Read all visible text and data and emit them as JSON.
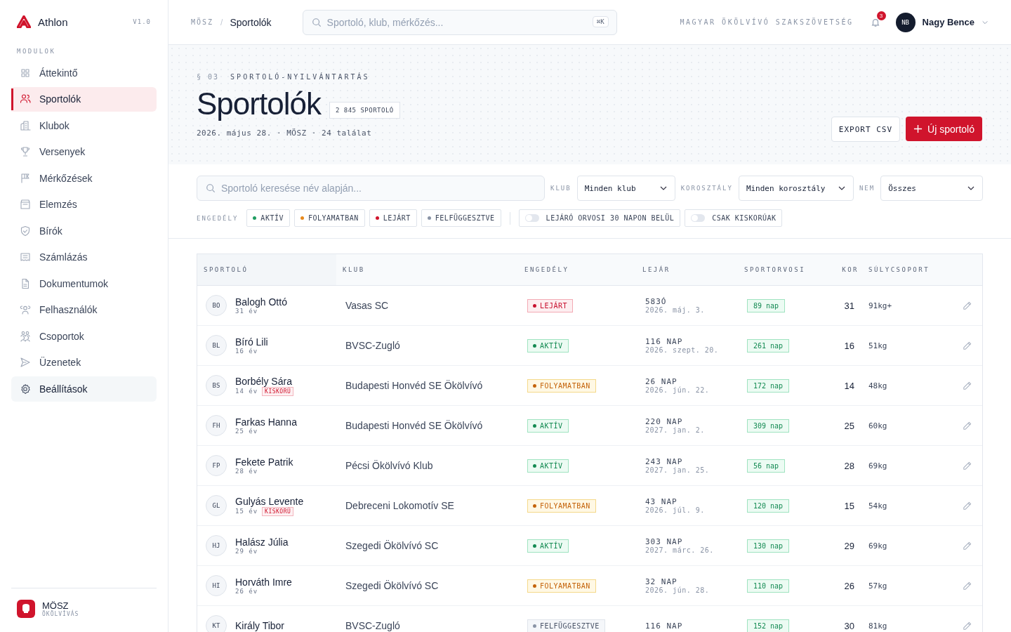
{
  "brand": {
    "name": "Athlon",
    "version": "V1.0"
  },
  "sidebar": {
    "section": "MODULOK",
    "items": [
      {
        "label": "Áttekintő",
        "selected": false,
        "highlighted": false
      },
      {
        "label": "Sportolók",
        "selected": true,
        "highlighted": false
      },
      {
        "label": "Klubok",
        "selected": false,
        "highlighted": false
      },
      {
        "label": "Versenyek",
        "selected": false,
        "highlighted": false
      },
      {
        "label": "Mérkőzések",
        "selected": false,
        "highlighted": false
      },
      {
        "label": "Elemzés",
        "selected": false,
        "highlighted": false
      },
      {
        "label": "Bírók",
        "selected": false,
        "highlighted": false
      },
      {
        "label": "Számlázás",
        "selected": false,
        "highlighted": false
      },
      {
        "label": "Dokumentumok",
        "selected": false,
        "highlighted": false
      },
      {
        "label": "Felhasználók",
        "selected": false,
        "highlighted": false
      },
      {
        "label": "Csoportok",
        "selected": false,
        "highlighted": false
      },
      {
        "label": "Üzenetek",
        "selected": false,
        "highlighted": false
      },
      {
        "label": "Beállítások",
        "selected": false,
        "highlighted": true
      }
    ],
    "footer": {
      "title": "MÖSZ",
      "subtitle": "ÖKÖLVÍVÁS"
    }
  },
  "topbar": {
    "breadcrumb": [
      "MÖSZ",
      "Sportolók"
    ],
    "breadcrumb_separator": "/",
    "search": {
      "placeholder": "Sportoló, klub, mérkőzés...",
      "shortcut": "⌘K"
    },
    "organization": "MAGYAR ÖKÖLVÍVÓ SZAKSZÖVETSÉG",
    "notifications": "3",
    "user": {
      "initials": "NB",
      "name": "Nagy Bence"
    }
  },
  "header": {
    "section": "§ 03",
    "eyebrow": "SPORTOLÓ-NYILVÁNTARTÁS",
    "title": "Sportolók",
    "count": "2 845 SPORTOLÓ",
    "meta": "2026. május 28. · MÖSZ · 24 találat",
    "buttons": [
      {
        "label": "EXPORT CSV",
        "kind": "secondary"
      },
      {
        "label": "Új sportoló",
        "kind": "primary"
      }
    ]
  },
  "filters": {
    "search": {
      "placeholder": "Sportoló keresése név alapján..."
    },
    "selects": [
      {
        "label": "KLUB",
        "value": "Minden klub"
      },
      {
        "label": "KOROSZTÁLY",
        "value": "Minden korosztály"
      },
      {
        "label": "NEM",
        "value": "Összes"
      }
    ],
    "license_label": "ENGEDÉLY",
    "license": [
      {
        "label": "AKTÍV",
        "color": "#1f9d61"
      },
      {
        "label": "FOLYAMATBAN",
        "color": "#e8891c"
      },
      {
        "label": "LEJÁRT",
        "color": "#d0142c"
      },
      {
        "label": "FELFÜGGESZTVE",
        "color": "#8a94a6"
      }
    ],
    "toggles": [
      {
        "label": "LEJÁRÓ ORVOSI 30 NAPON BELÜL",
        "on": false
      },
      {
        "label": "CSAK KISKORÚAK",
        "on": false
      }
    ]
  },
  "table": {
    "columns": [
      "SPORTOLÓ",
      "KLUB",
      "ENGEDÉLY",
      "LEJÁR",
      "SPORTORVOSI",
      "KOR",
      "SÚLYCSOPORT"
    ],
    "rows": [
      {
        "initials": "BO",
        "name": "Balogh Ottó",
        "years": "31 év",
        "club": "Vasas SC",
        "status": {
          "label": "LEJÁRT",
          "kind": "expired"
        },
        "expiry": "583Ó",
        "expiry_date": "2026. máj. 3.",
        "medical": "89 nap",
        "age": "31",
        "weight": "91kg+"
      },
      {
        "initials": "BL",
        "name": "Bíró Lili",
        "years": "16 év",
        "club": "BVSC-Zugló",
        "status": {
          "label": "AKTÍV",
          "kind": "active"
        },
        "expiry": "116 NAP",
        "expiry_date": "2026. szept. 20.",
        "medical": "261 nap",
        "age": "16",
        "weight": "51kg"
      },
      {
        "initials": "BS",
        "name": "Borbély Sára",
        "years": "14 év",
        "tag": "KISKORÚ",
        "club": "Budapesti Honvéd SE Ökölvívó",
        "status": {
          "label": "FOLYAMATBAN",
          "kind": "pending"
        },
        "expiry": "26 NAP",
        "expiry_date": "2026. jún. 22.",
        "medical": "172 nap",
        "age": "14",
        "weight": "48kg"
      },
      {
        "initials": "FH",
        "name": "Farkas Hanna",
        "years": "25 év",
        "club": "Budapesti Honvéd SE Ökölvívó",
        "status": {
          "label": "AKTÍV",
          "kind": "active"
        },
        "expiry": "220 NAP",
        "expiry_date": "2027. jan. 2.",
        "medical": "309 nap",
        "age": "25",
        "weight": "60kg"
      },
      {
        "initials": "FP",
        "name": "Fekete Patrik",
        "years": "28 év",
        "club": "Pécsi Ökölvívó Klub",
        "status": {
          "label": "AKTÍV",
          "kind": "active"
        },
        "expiry": "243 NAP",
        "expiry_date": "2027. jan. 25.",
        "medical": "56 nap",
        "age": "28",
        "weight": "69kg"
      },
      {
        "initials": "GL",
        "name": "Gulyás Levente",
        "years": "15 év",
        "tag": "KISKORÚ",
        "club": "Debreceni Lokomotív SE",
        "status": {
          "label": "FOLYAMATBAN",
          "kind": "pending"
        },
        "expiry": "43 NAP",
        "expiry_date": "2026. júl. 9.",
        "medical": "120 nap",
        "age": "15",
        "weight": "54kg"
      },
      {
        "initials": "HJ",
        "name": "Halász Júlia",
        "years": "29 év",
        "club": "Szegedi Ökölvívó SC",
        "status": {
          "label": "AKTÍV",
          "kind": "active"
        },
        "expiry": "303 NAP",
        "expiry_date": "2027. márc. 26.",
        "medical": "130 nap",
        "age": "29",
        "weight": "69kg"
      },
      {
        "initials": "HI",
        "name": "Horváth Imre",
        "years": "26 év",
        "club": "Szegedi Ökölvívó SC",
        "status": {
          "label": "FOLYAMATBAN",
          "kind": "pending"
        },
        "expiry": "32 NAP",
        "expiry_date": "2026. jún. 28.",
        "medical": "110 nap",
        "age": "26",
        "weight": "57kg"
      },
      {
        "initials": "KT",
        "name": "Király Tibor",
        "club": "BVSC-Zugló",
        "status": {
          "label": "FELFÜGGESZTVE",
          "kind": "suspended"
        },
        "expiry": "116 NAP",
        "medical": "152 nap",
        "age": "30",
        "weight": "81kg"
      }
    ]
  }
}
